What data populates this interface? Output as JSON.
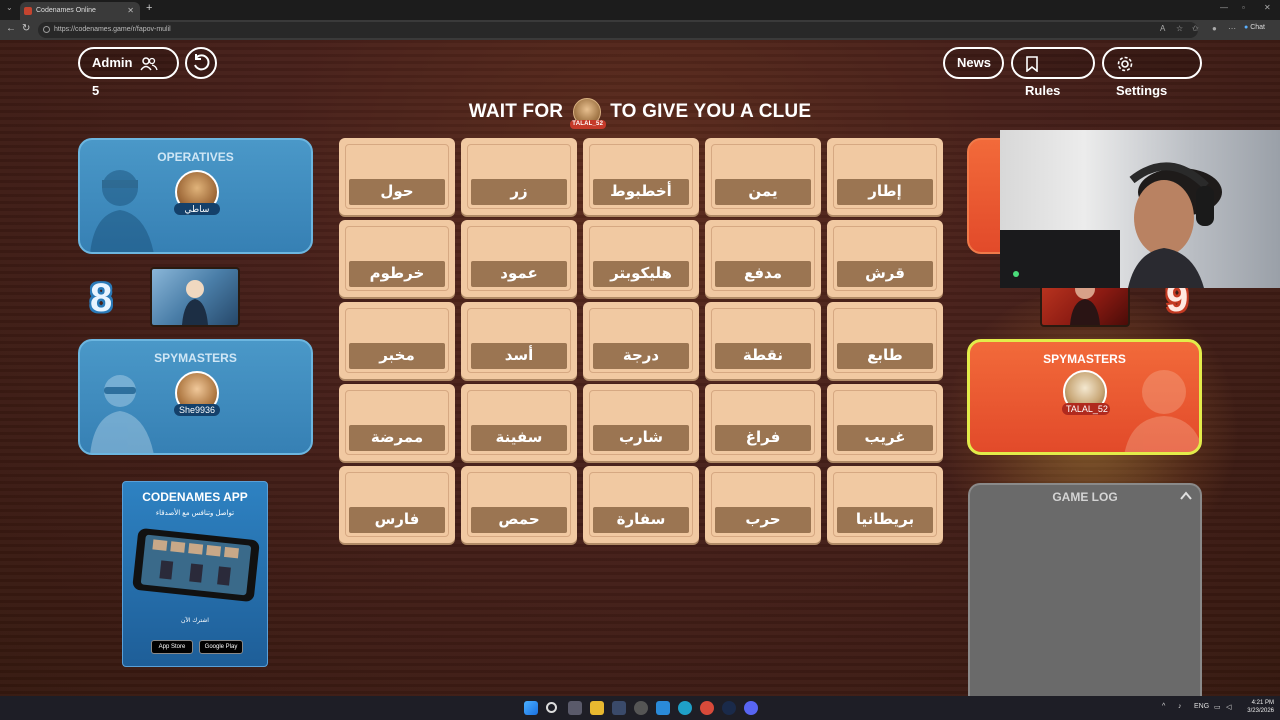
{
  "browser": {
    "tab_title": "Codenames Online",
    "url": "https://codenames.game/r/fapov-mulil",
    "chat_label": "Chat"
  },
  "header": {
    "admin_label": "Admin",
    "player_count": "5",
    "news_label": "News",
    "rules_label": "Rules",
    "settings_label": "Settings"
  },
  "clue": {
    "prefix": "WAIT FOR",
    "player": "TALAL_52",
    "suffix": "TO GIVE YOU A CLUE"
  },
  "blue_team": {
    "operatives_title": "OPERATIVES",
    "operative_name": "ساطي",
    "score": "8",
    "spymasters_title": "SPYMASTERS",
    "spymaster_name": "She9936",
    "color": "#3a88bc"
  },
  "red_team": {
    "score": "9",
    "spymasters_title": "SPYMASTERS",
    "spymaster_name": "TALAL_52",
    "color": "#ee5a32"
  },
  "board": {
    "cards": [
      "حول",
      "زر",
      "أخطبوط",
      "يمن",
      "إطار",
      "خرطوم",
      "عمود",
      "هليكوبتر",
      "مدفع",
      "قرش",
      "مخبر",
      "أسد",
      "درجة",
      "نقطة",
      "طابع",
      "ممرضة",
      "سفينة",
      "شارب",
      "فراغ",
      "غريب",
      "فارس",
      "حمص",
      "سفارة",
      "حرب",
      "بريطانيا"
    ]
  },
  "promo": {
    "title": "CODENAMES APP",
    "subtitle": "تواصل وتنافس مع الأصدقاء",
    "join": "اشترك الآن",
    "app_store": "App Store",
    "google_play": "Google Play"
  },
  "gamelog": {
    "title": "GAME LOG"
  },
  "taskbar": {
    "lang": "ENG",
    "time": "4:21 PM",
    "date": "3/23/2026"
  }
}
